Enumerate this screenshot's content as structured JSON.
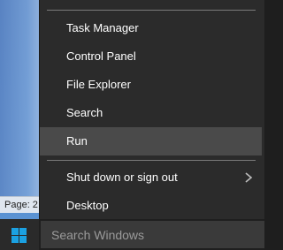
{
  "desktop": {
    "status_label": "Page: 2"
  },
  "menu": {
    "items": [
      {
        "label": "Task Manager",
        "highlighted": false,
        "has_submenu": false
      },
      {
        "label": "Control Panel",
        "highlighted": false,
        "has_submenu": false
      },
      {
        "label": "File Explorer",
        "highlighted": false,
        "has_submenu": false
      },
      {
        "label": "Search",
        "highlighted": false,
        "has_submenu": false
      },
      {
        "label": "Run",
        "highlighted": true,
        "has_submenu": false
      },
      {
        "label": "Shut down or sign out",
        "highlighted": false,
        "has_submenu": true,
        "submenu_icon": "chevron-right-icon"
      },
      {
        "label": "Desktop",
        "highlighted": false,
        "has_submenu": false
      }
    ]
  },
  "taskbar": {
    "start_icon": "windows-logo-icon",
    "search_placeholder": "Search Windows"
  },
  "colors": {
    "menu_background": "#2b2b2b",
    "menu_highlight": "#4a4a4a",
    "menu_text": "#ffffff",
    "separator": "#7a7a7a",
    "taskbar": "#1f1f1f",
    "windows_logo": "#1ba1e2"
  }
}
